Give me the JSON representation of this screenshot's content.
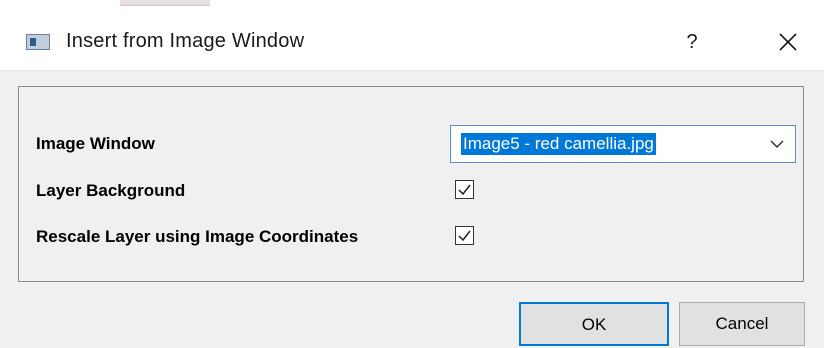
{
  "window": {
    "title": "Insert from Image Window",
    "help_label": "?",
    "icon": "app-window-icon",
    "close_icon": "close-icon"
  },
  "form": {
    "image_window": {
      "label": "Image Window",
      "selected": "Image5 - red camellia.jpg"
    },
    "layer_background": {
      "label": "Layer Background",
      "checked": true
    },
    "rescale_layer": {
      "label": "Rescale Layer using Image Coordinates",
      "checked": true
    }
  },
  "buttons": {
    "ok_label": "OK",
    "cancel_label": "Cancel"
  },
  "colors": {
    "accent": "#0078d7",
    "dialog_bg": "#f0f0f0",
    "button_bg": "#e1e1e1"
  }
}
